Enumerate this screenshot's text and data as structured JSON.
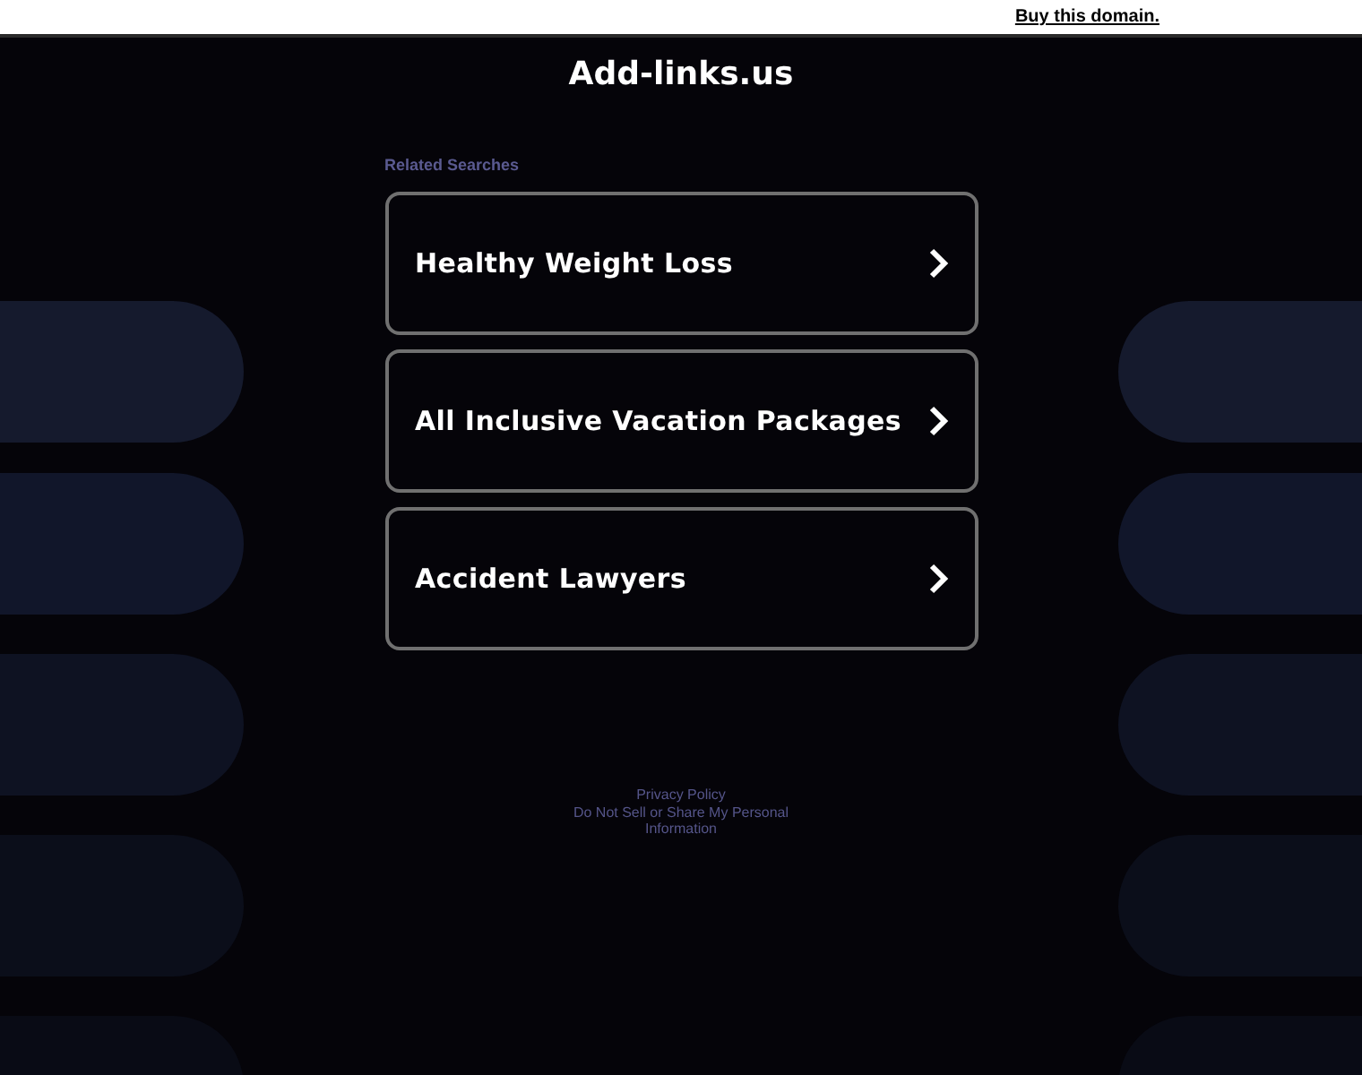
{
  "top_bar": {
    "link": "Buy this domain."
  },
  "site_title": "Add-links.us",
  "related_heading": "Related Searches",
  "searches": [
    {
      "label": "Healthy Weight Loss"
    },
    {
      "label": "All Inclusive Vacation Packages"
    },
    {
      "label": "Accident Lawyers"
    }
  ],
  "footer": {
    "privacy": "Privacy Policy",
    "do_not_sell": "Do Not Sell or Share My Personal Information"
  }
}
